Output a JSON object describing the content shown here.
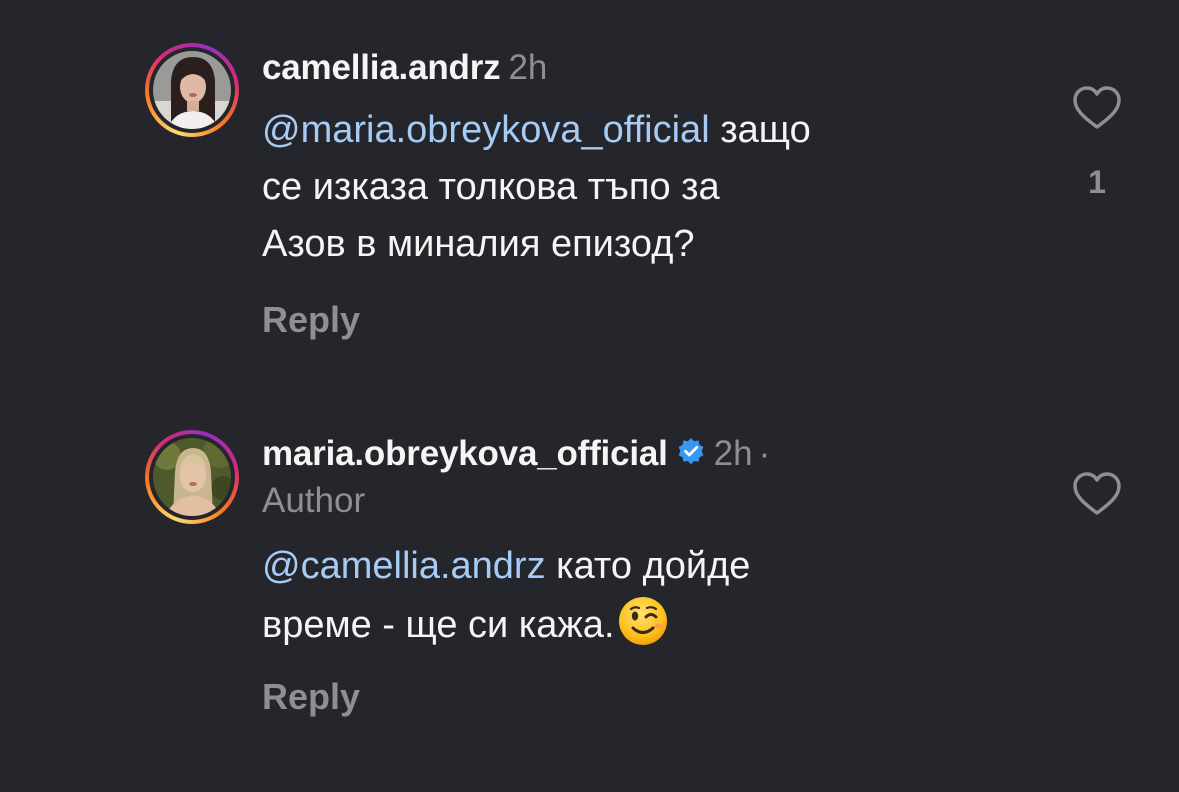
{
  "comments": [
    {
      "username": "camellia.andrz",
      "time": "2h",
      "mention": "@maria.obreykova_official",
      "text_line1": " защо",
      "text_line2": "се изказа толкова тъпо за",
      "text_line3": "Азов в миналия епизод?",
      "reply_label": "Reply",
      "like_count": "1"
    },
    {
      "username": "maria.obreykova_official",
      "time": "2h",
      "separator": "·",
      "author_label": "Author",
      "mention": "@camellia.andrz",
      "text_line1": " като дойде",
      "text_line2": "време - ще си кажа.",
      "emoji": "winking-face",
      "reply_label": "Reply"
    }
  ],
  "colors": {
    "background": "#25262b",
    "mention": "#a6cbf5",
    "secondary": "#8e8f93",
    "verified": "#3897f0"
  }
}
